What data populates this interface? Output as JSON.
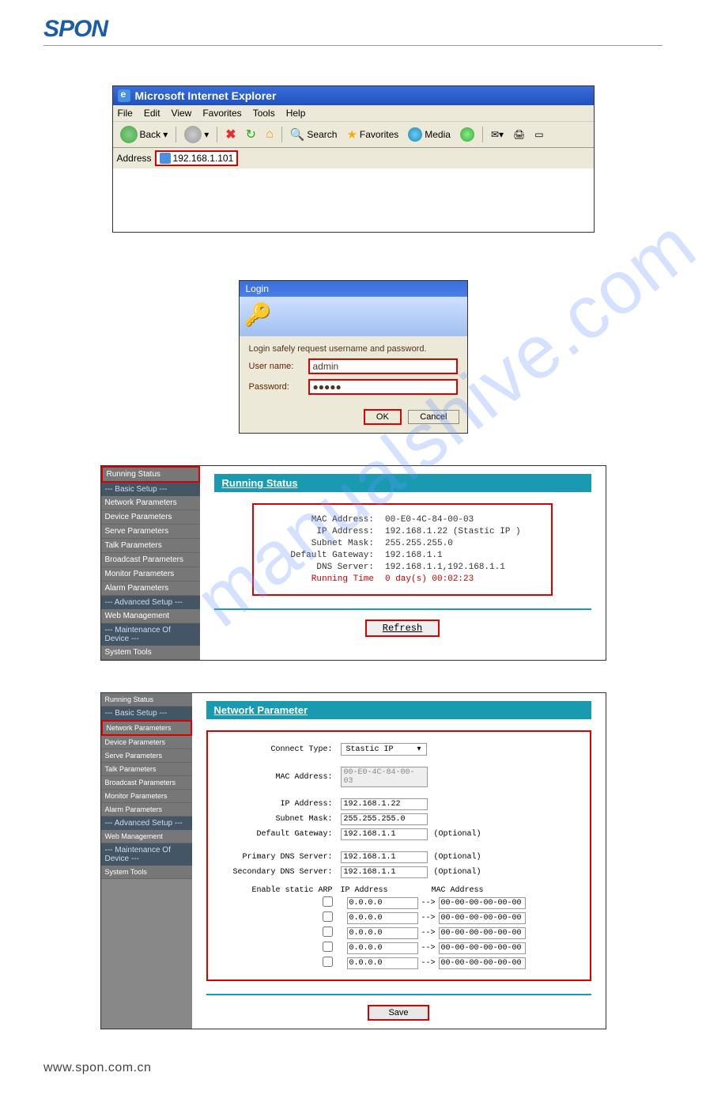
{
  "logo": "SPON",
  "footer": "www.spon.com.cn",
  "watermark": "manualshive.com",
  "ie": {
    "title": "Microsoft Internet Explorer",
    "menu": [
      "File",
      "Edit",
      "View",
      "Favorites",
      "Tools",
      "Help"
    ],
    "back": "Back",
    "search": "Search",
    "favorites": "Favorites",
    "media": "Media",
    "address_label": "Address",
    "address_value": "192.168.1.101"
  },
  "login": {
    "title": "Login",
    "prompt": "Login safely request username and password.",
    "user_label": "User name:",
    "pass_label": "Password:",
    "user_value": "admin",
    "pass_value": "●●●●●",
    "ok": "OK",
    "cancel": "Cancel"
  },
  "sidebar1": {
    "items": [
      "Running Status",
      "--- Basic Setup ---",
      "Network Parameters",
      "Device Parameters",
      "Serve Parameters",
      "Talk Parameters",
      "Broadcast Parameters",
      "Monitor Parameters",
      "Alarm Parameters",
      "--- Advanced Setup ---",
      "Web Management",
      "--- Maintenance Of Device ---",
      "System Tools"
    ]
  },
  "status": {
    "title": "Running Status",
    "rows": [
      {
        "label": "MAC Address:",
        "value": "00-E0-4C-84-00-03"
      },
      {
        "label": "IP Address:",
        "value": "192.168.1.22  (Stastic IP )"
      },
      {
        "label": "Subnet Mask:",
        "value": "255.255.255.0"
      },
      {
        "label": "Default Gateway:",
        "value": "192.168.1.1"
      },
      {
        "label": "DNS Server:",
        "value": "192.168.1.1,192.168.1.1"
      },
      {
        "label": "Running Time",
        "value": "0 day(s) 00:02:23"
      }
    ],
    "refresh": "Refresh"
  },
  "netparam": {
    "title": "Network Parameter",
    "connect_type_label": "Connect Type:",
    "connect_type_value": "Stastic IP",
    "mac_label": "MAC Address:",
    "mac_value": "00-E0-4C-84-00-03",
    "ip_label": "IP Address:",
    "ip_value": "192.168.1.22",
    "mask_label": "Subnet Mask:",
    "mask_value": "255.255.255.0",
    "gw_label": "Default Gateway:",
    "gw_value": "192.168.1.1",
    "optional": "(Optional)",
    "dns1_label": "Primary DNS Server:",
    "dns1_value": "192.168.1.1",
    "dns2_label": "Secondary DNS Server:",
    "dns2_value": "192.168.1.1",
    "arp_label": "Enable static ARP",
    "arp_ip_header": "IP Address",
    "arp_mac_header": "MAC Address",
    "arp_ip_default": "0.0.0.0",
    "arp_mac_default": "00-00-00-00-00-00",
    "arrow": "-->",
    "save": "Save"
  }
}
